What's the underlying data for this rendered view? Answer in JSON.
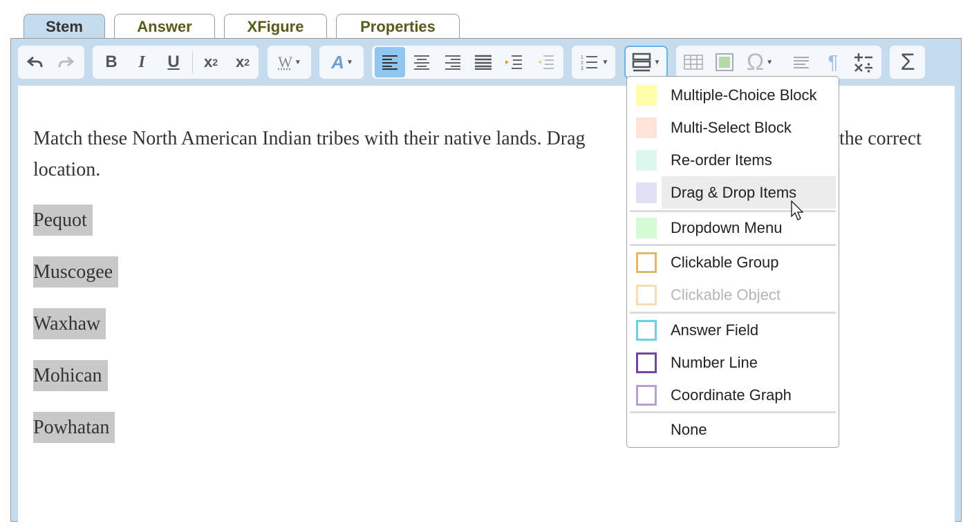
{
  "tabs": [
    {
      "label": "Stem",
      "active": true
    },
    {
      "label": "Answer",
      "active": false
    },
    {
      "label": "XFigure",
      "active": false
    },
    {
      "label": "Properties",
      "active": false
    }
  ],
  "toolbar": {
    "undo": "undo-icon",
    "redo": "redo-icon",
    "bold": "B",
    "italic": "I",
    "underline": "U",
    "subscript_base": "x",
    "subscript_mark": "2",
    "superscript_base": "x",
    "superscript_mark": "2",
    "word_icon": "W",
    "font_icon": "A",
    "align_left": "align-left-icon",
    "align_center": "align-center-icon",
    "align_right": "align-right-icon",
    "justify": "justify-icon",
    "indent": "indent-icon",
    "outdent": "outdent-icon",
    "list": "numbered-list-icon",
    "block_insert": "block-insert-icon",
    "table": "table-icon",
    "image": "image-icon",
    "omega": "Ω",
    "text_lines": "text-lines-icon",
    "pilcrow": "¶",
    "math_ops": "math-ops-icon",
    "sigma": "Σ"
  },
  "stem": {
    "text_part1": "Match these North American Indian tribes with their native lands. Drag",
    "text_part2": "the correct",
    "text_line2": "location.",
    "tribes": [
      "Pequot",
      "Muscogee",
      "Waxhaw",
      "Mohican",
      "Powhatan"
    ]
  },
  "menu": {
    "items": [
      {
        "label": "Multiple-Choice Block",
        "swatch": "#ffffaa",
        "style": "fill"
      },
      {
        "label": "Multi-Select Block",
        "swatch": "#ffe3d8",
        "style": "fill"
      },
      {
        "label": "Re-order Items",
        "swatch": "#dcf7ee",
        "style": "fill"
      },
      {
        "label": "Drag & Drop Items",
        "swatch": "#e2e0f5",
        "style": "fill",
        "hover": true
      },
      {
        "label": "Dropdown Menu",
        "swatch": "#d4fbd4",
        "style": "fill"
      },
      {
        "label": "Clickable Group",
        "swatch": "#e8b766",
        "style": "outline"
      },
      {
        "label": "Clickable Object",
        "swatch": "#f4ddb6",
        "style": "outline",
        "disabled": true
      },
      {
        "label": "Answer Field",
        "swatch": "#6ed0e4",
        "style": "outline"
      },
      {
        "label": "Number Line",
        "swatch": "#6e4a9e",
        "style": "outline"
      },
      {
        "label": "Coordinate Graph",
        "swatch": "#b6a1cf",
        "style": "outline"
      },
      {
        "label": "None",
        "swatch": "",
        "style": "none"
      }
    ]
  }
}
